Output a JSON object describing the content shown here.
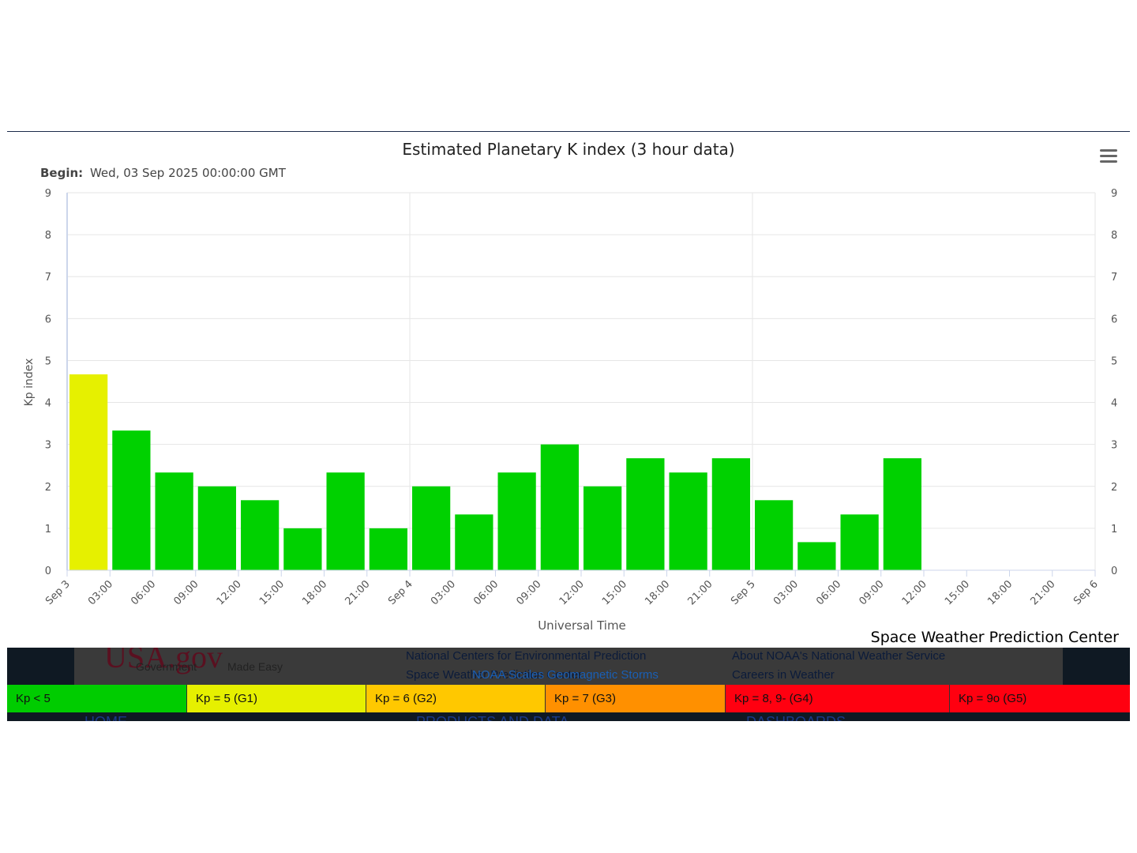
{
  "chart_data": {
    "type": "bar",
    "title": "Estimated Planetary K index (3 hour data)",
    "subtitle_label": "Begin:",
    "subtitle_value": "Wed, 03 Sep 2025 00:00:00 GMT",
    "ylabel": "Kp index",
    "xlabel": "Universal Time",
    "ylim": [
      0,
      9
    ],
    "yticks": [
      0,
      1,
      2,
      3,
      4,
      5,
      6,
      7,
      8,
      9
    ],
    "x_tick_labels": [
      "Sep 3",
      "03:00",
      "06:00",
      "09:00",
      "12:00",
      "15:00",
      "18:00",
      "21:00",
      "Sep 4",
      "03:00",
      "06:00",
      "09:00",
      "12:00",
      "15:00",
      "18:00",
      "21:00",
      "Sep 5",
      "03:00",
      "06:00",
      "09:00",
      "12:00",
      "15:00",
      "18:00",
      "21:00",
      "Sep 6"
    ],
    "categories": [
      "Sep 3 00:00",
      "Sep 3 03:00",
      "Sep 3 06:00",
      "Sep 3 09:00",
      "Sep 3 12:00",
      "Sep 3 15:00",
      "Sep 3 18:00",
      "Sep 3 21:00",
      "Sep 4 00:00",
      "Sep 4 03:00",
      "Sep 4 06:00",
      "Sep 4 09:00",
      "Sep 4 12:00",
      "Sep 4 15:00",
      "Sep 4 18:00",
      "Sep 4 21:00",
      "Sep 5 00:00",
      "Sep 5 03:00",
      "Sep 5 06:00",
      "Sep 5 09:00"
    ],
    "values": [
      4.67,
      3.33,
      2.33,
      2.0,
      1.67,
      1.0,
      2.33,
      1.0,
      2.0,
      1.33,
      2.33,
      3.0,
      2.0,
      2.67,
      2.33,
      2.67,
      1.67,
      0.67,
      1.33,
      2.67
    ],
    "bar_colors": [
      "#e6f000",
      "#00d100",
      "#00d100",
      "#00d100",
      "#00d100",
      "#00d100",
      "#00d100",
      "#00d100",
      "#00d100",
      "#00d100",
      "#00d100",
      "#00d100",
      "#00d100",
      "#00d100",
      "#00d100",
      "#00d100",
      "#00d100",
      "#00d100",
      "#00d100",
      "#00d100"
    ],
    "grid": true,
    "credit": "Space Weather Prediction Center"
  },
  "menu_icon": "hamburger-menu-icon",
  "footer_ghost": {
    "logo": "USA.gov",
    "logo_sub_left": "Government",
    "logo_sub_right": "Made Easy",
    "col2_line1": "National Centers for Environmental Prediction",
    "col2_line2": "Space Weather Prediction Center",
    "col2_link": "NOAA Scales Geomagnetic Storms",
    "col3_line1": "About NOAA's National Weather Service",
    "col3_line2": "Careers in Weather",
    "nav_home": "HOME",
    "nav_products": "PRODUCTS AND DATA",
    "nav_dashboards": "DASHBOARDS"
  },
  "scale_legend": [
    {
      "label": "Kp < 5",
      "color": "#00cc00"
    },
    {
      "label": "Kp = 5 (G1)",
      "color": "#e6f000"
    },
    {
      "label": "Kp = 6 (G2)",
      "color": "#ffc800"
    },
    {
      "label": "Kp = 7 (G3)",
      "color": "#ff9000"
    },
    {
      "label": "Kp = 8, 9- (G4)",
      "color": "#ff0010"
    },
    {
      "label": "Kp = 9o (G5)",
      "color": "#ff0010"
    }
  ]
}
